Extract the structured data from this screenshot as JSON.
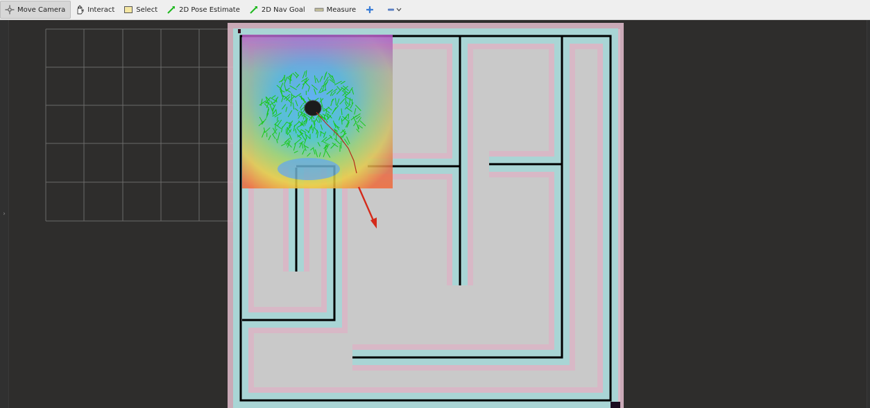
{
  "toolbar": {
    "move_camera": "Move Camera",
    "interact": "Interact",
    "select": "Select",
    "pose_estimate": "2D Pose Estimate",
    "nav_goal": "2D Nav Goal",
    "measure": "Measure"
  },
  "icons": {
    "move_camera": "move-camera-icon",
    "interact": "hand-icon",
    "select": "select-box-icon",
    "pose_estimate": "green-arrow-icon",
    "nav_goal": "green-arrow-icon",
    "measure": "ruler-icon",
    "add_tool": "crosshair-plus-icon",
    "remove_tool": "minus-dropdown-icon"
  },
  "colors": {
    "toolbar_bg": "#efefef",
    "viewport_bg": "#2e2d2c",
    "grid": "#8c8c8c",
    "map_free": "#c7c7c7",
    "inflation": "#d7b5c4",
    "wall": "#000000",
    "goal_arrow": "#d42a1a",
    "particles": "#19d119"
  }
}
